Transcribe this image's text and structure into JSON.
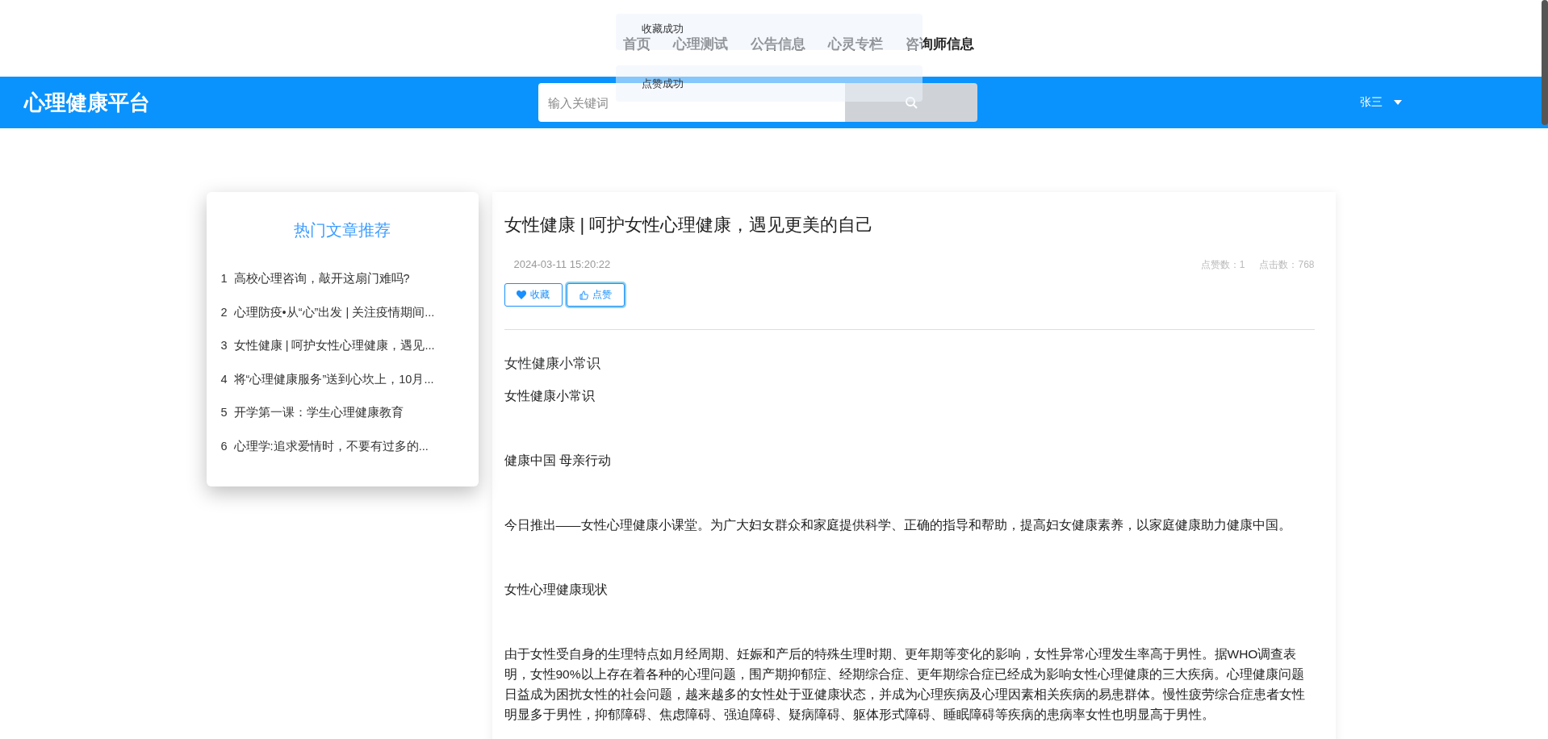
{
  "nav": {
    "items": [
      {
        "label": "首页"
      },
      {
        "label": "心理测试"
      },
      {
        "label": "公告信息"
      },
      {
        "label": "心灵专栏"
      },
      {
        "label": "咨询师信息"
      }
    ]
  },
  "header": {
    "logo": "心理健康平台",
    "search": {
      "placeholder": "输入关键词"
    },
    "user": "张三"
  },
  "toasts": [
    "收藏成功",
    "点赞成功"
  ],
  "sidebar": {
    "title": "热门文章推荐",
    "items": [
      {
        "index": "1",
        "title": "高校心理咨询，敲开这扇门难吗?"
      },
      {
        "index": "2",
        "title": "心理防疫•从“心”出发 | 关注疫情期间..."
      },
      {
        "index": "3",
        "title": "女性健康 | 呵护女性心理健康，遇见..."
      },
      {
        "index": "4",
        "title": "将“心理健康服务”送到心坎上，10月..."
      },
      {
        "index": "5",
        "title": "开学第一课：学生心理健康教育"
      },
      {
        "index": "6",
        "title": "心理学:追求爱情时，不要有过多的..."
      }
    ]
  },
  "article": {
    "title": "女性健康 | 呵护女性心理健康，遇见更美的自己",
    "date": "2024-03-11 15:20:22",
    "likes": "点赞数：1",
    "clicks": "点击数：768",
    "buttons": [
      {
        "kind": "favorite",
        "label": "收藏"
      },
      {
        "kind": "like",
        "label": "点赞"
      }
    ],
    "subheading": "女性健康小常识",
    "paragraphs": [
      "女性健康小常识",
      "健康中国 母亲行动",
      "今日推出——女性心理健康小课堂。为广大妇女群众和家庭提供科学、正确的指导和帮助，提高妇女健康素养，以家庭健康助力健康中国。",
      "女性心理健康现状",
      "由于女性受自身的生理特点如月经周期、妊娠和产后的特殊生理时期、更年期等变化的影响，女性异常心理发生率高于男性。据WHO调查表明，女性90%以上存在着各种的心理问题，围产期抑郁症、经期综合症、更年期综合症已经成为影响女性心理健康的三大疾病。心理健康问题日益成为困扰女性的社会问题，越来越多的女性处于亚健康状态，并成为心理疾病及心理因素相关疾病的易患群体。慢性疲劳综合症患者女性明显多于男性，抑郁障碍、焦虑障碍、强迫障碍、疑病障碍、躯体形式障碍、睡眠障碍等疾病的患病率女性也明显高于男性。"
    ]
  }
}
